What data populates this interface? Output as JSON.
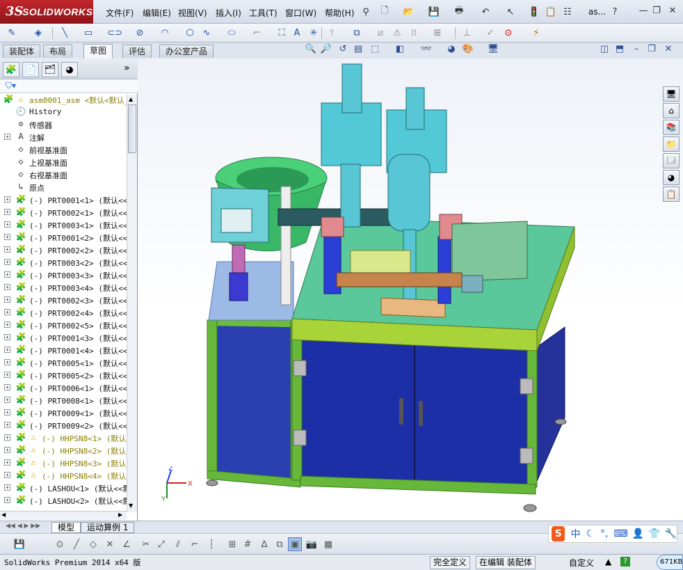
{
  "app": {
    "logo_ds": "3S",
    "logo_text": "SOLIDWORKS",
    "doc_title": "as...",
    "menus": [
      "文件(F)",
      "编辑(E)",
      "视图(V)",
      "插入(I)",
      "工具(T)",
      "窗口(W)",
      "帮助(H)"
    ]
  },
  "tabs": [
    "装配体",
    "布局",
    "草图",
    "评估",
    "办公室产品"
  ],
  "active_tab": "草图",
  "tree": {
    "root": "asm0001_asm  <默认<默认_",
    "items": [
      {
        "icon": "history-icon",
        "label": "History",
        "exp": false,
        "warn": false
      },
      {
        "icon": "sensor-icon",
        "label": "传感器",
        "exp": false,
        "warn": false
      },
      {
        "icon": "annotation-icon",
        "label": "注解",
        "exp": true,
        "warn": false
      },
      {
        "icon": "plane-icon",
        "label": "前视基准面",
        "exp": false,
        "warn": false
      },
      {
        "icon": "plane-icon",
        "label": "上视基准面",
        "exp": false,
        "warn": false
      },
      {
        "icon": "plane-icon",
        "label": "右视基准面",
        "exp": false,
        "warn": false
      },
      {
        "icon": "origin-icon",
        "label": "原点",
        "exp": false,
        "warn": false
      },
      {
        "icon": "part-icon",
        "label": "(-) PRT0001<1> (默认<<默",
        "exp": true,
        "warn": false
      },
      {
        "icon": "part-icon",
        "label": "(-) PRT0002<1> (默认<<默",
        "exp": true,
        "warn": false
      },
      {
        "icon": "part-icon",
        "label": "(-) PRT0003<1> (默认<<默",
        "exp": true,
        "warn": false
      },
      {
        "icon": "part-icon",
        "label": "(-) PRT0001<2> (默认<<默",
        "exp": true,
        "warn": false
      },
      {
        "icon": "part-icon",
        "label": "(-) PRT0002<2> (默认<<默",
        "exp": true,
        "warn": false
      },
      {
        "icon": "part-icon",
        "label": "(-) PRT0003<2> (默认<<默",
        "exp": true,
        "warn": false
      },
      {
        "icon": "part-icon",
        "label": "(-) PRT0003<3> (默认<<默",
        "exp": true,
        "warn": false
      },
      {
        "icon": "part-icon",
        "label": "(-) PRT0003<4> (默认<<默",
        "exp": true,
        "warn": false
      },
      {
        "icon": "part-icon",
        "label": "(-) PRT0002<3> (默认<<默",
        "exp": true,
        "warn": false
      },
      {
        "icon": "part-icon",
        "label": "(-) PRT0002<4> (默认<<默",
        "exp": true,
        "warn": false
      },
      {
        "icon": "part-icon",
        "label": "(-) PRT0002<5> (默认<<默",
        "exp": true,
        "warn": false
      },
      {
        "icon": "part-icon",
        "label": "(-) PRT0001<3> (默认<<默",
        "exp": true,
        "warn": false
      },
      {
        "icon": "part-icon",
        "label": "(-) PRT0001<4> (默认<<默",
        "exp": true,
        "warn": false
      },
      {
        "icon": "part-icon",
        "label": "(-) PRT0005<1> (默认<<默",
        "exp": true,
        "warn": false
      },
      {
        "icon": "part-icon",
        "label": "(-) PRT0005<2> (默认<<默",
        "exp": true,
        "warn": false
      },
      {
        "icon": "part-icon",
        "label": "(-) PRT0006<1> (默认<<默",
        "exp": true,
        "warn": false
      },
      {
        "icon": "part-icon",
        "label": "(-) PRT0008<1> (默认<<默",
        "exp": true,
        "warn": false
      },
      {
        "icon": "part-icon",
        "label": "(-) PRT0009<1> (默认<<默",
        "exp": true,
        "warn": false
      },
      {
        "icon": "part-icon",
        "label": "(-) PRT0009<2> (默认<<默",
        "exp": true,
        "warn": false
      },
      {
        "icon": "part-icon",
        "label": "(-) HHPSN8<1> (默认<",
        "exp": true,
        "warn": true
      },
      {
        "icon": "part-icon",
        "label": "(-) HHPSN8<2> (默认<",
        "exp": true,
        "warn": true
      },
      {
        "icon": "part-icon",
        "label": "(-) HHPSN8<3> (默认<",
        "exp": true,
        "warn": true
      },
      {
        "icon": "part-icon",
        "label": "(-) HHPSN8<4> (默认<",
        "exp": true,
        "warn": true
      },
      {
        "icon": "part-icon",
        "label": "(-) LASHOU<1> (默认<<默",
        "exp": true,
        "warn": false
      },
      {
        "icon": "part-icon",
        "label": "(-) LASHOU<2> (默认<<默",
        "exp": true,
        "warn": false
      }
    ]
  },
  "bottom_tabs": [
    "模型",
    "运动算例 1"
  ],
  "status": {
    "product": "SolidWorks Premium 2014 x64 版",
    "defined": "完全定义",
    "editing": "在编辑 装配体",
    "units": "自定义",
    "net": "671KB/"
  },
  "triad": {
    "x": "X",
    "y": "Y",
    "z": "Z"
  },
  "ime": {
    "mode": "中"
  }
}
